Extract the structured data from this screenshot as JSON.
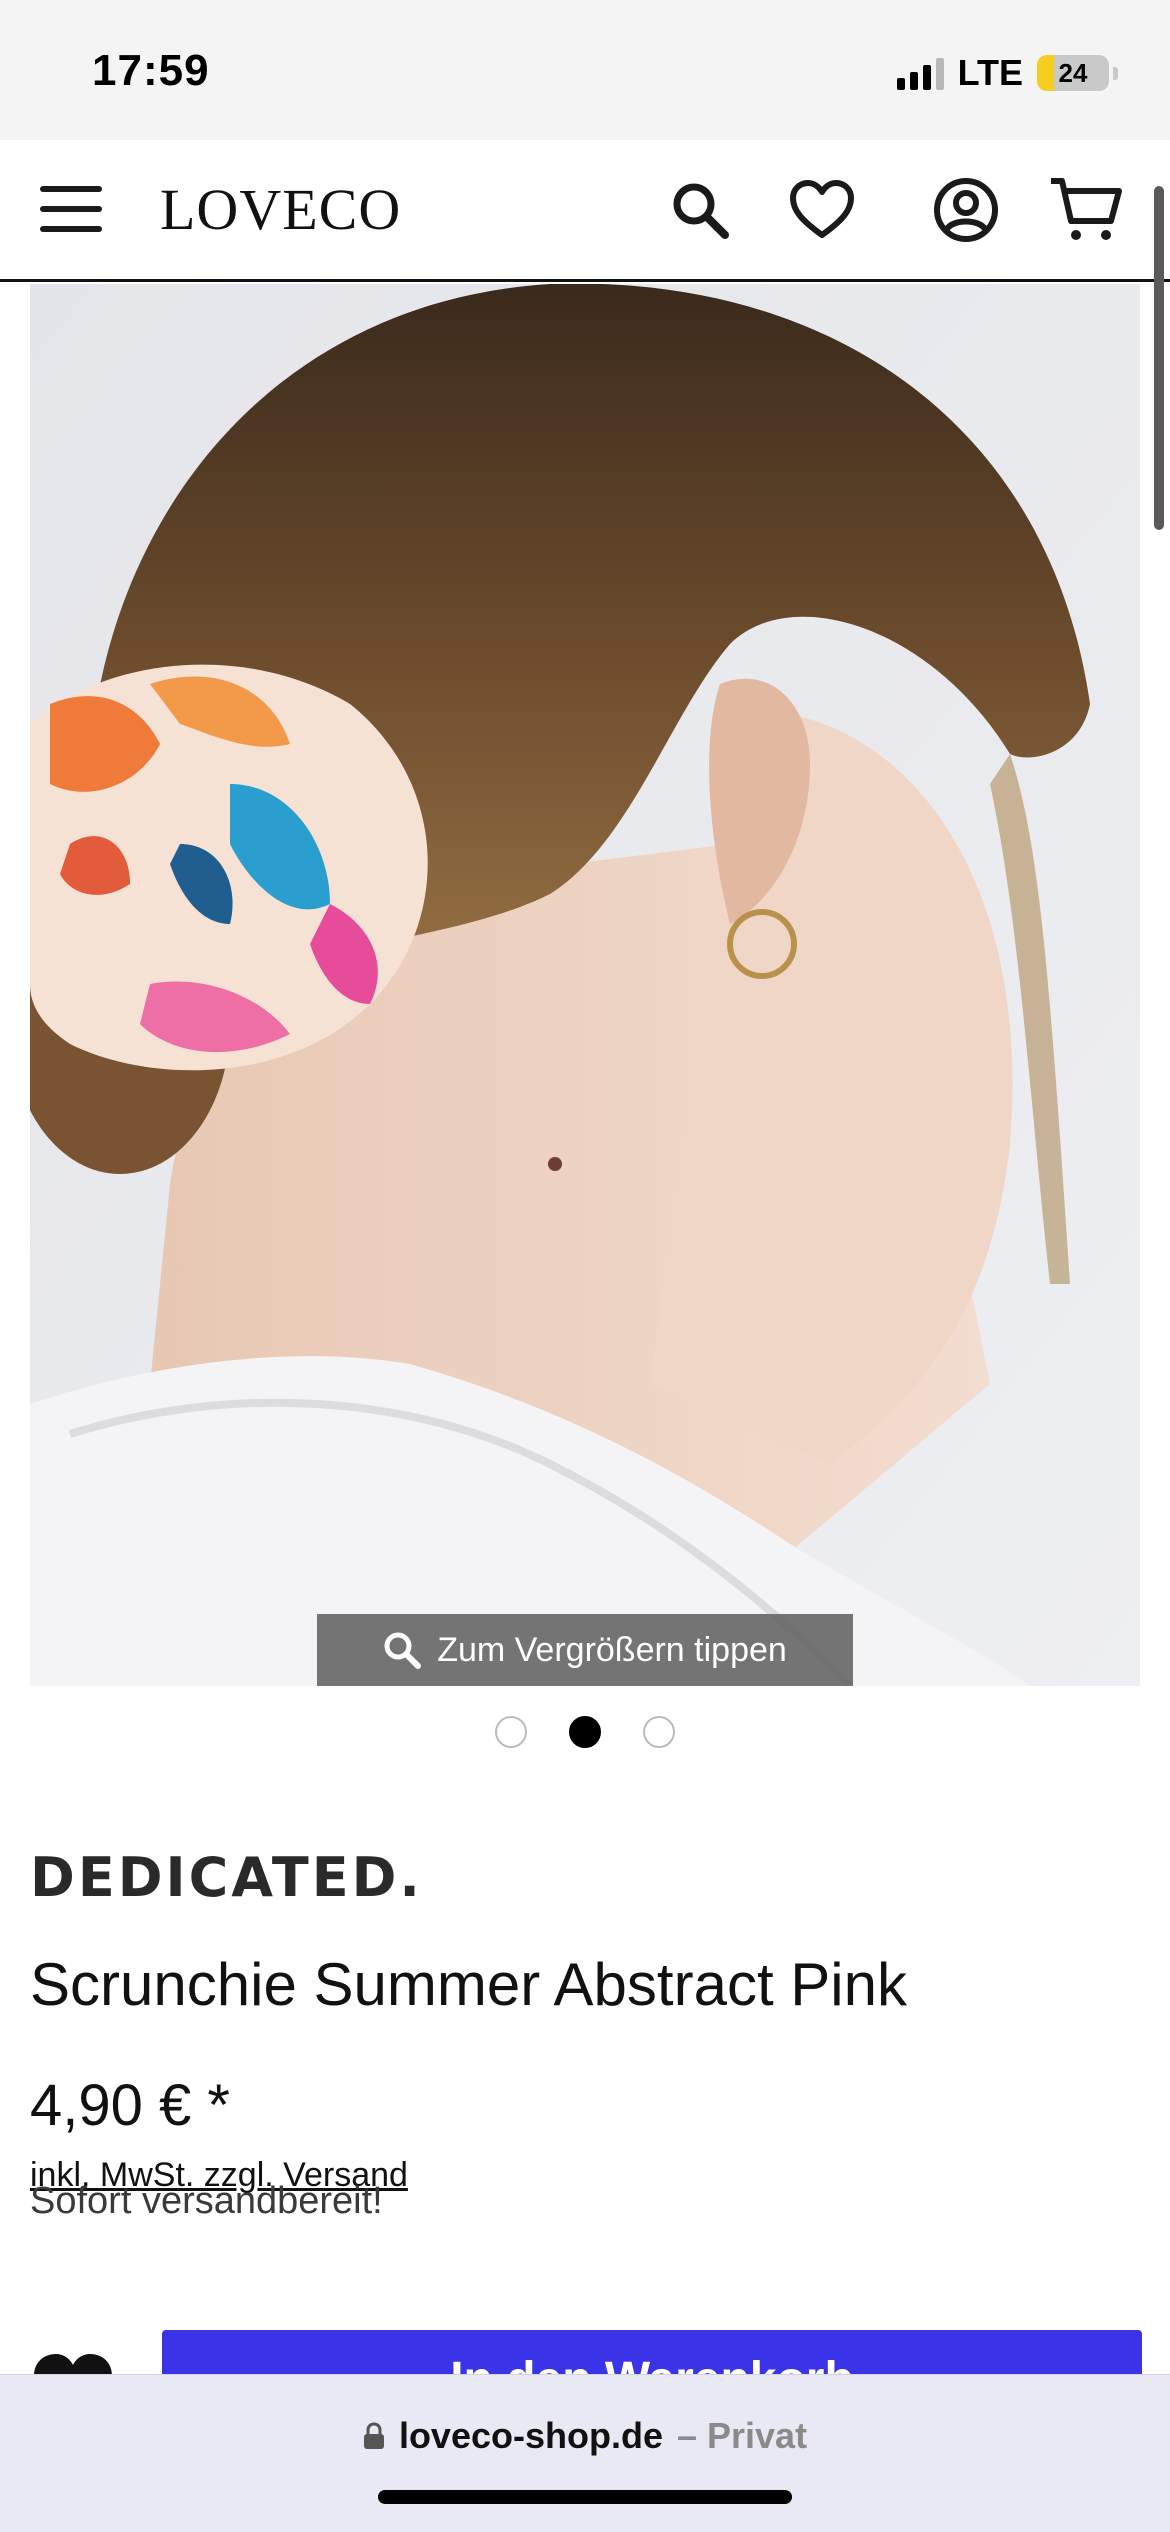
{
  "status_bar": {
    "time": "17:59",
    "network": "LTE",
    "battery_level": "24",
    "battery_color": "#f7cd1f"
  },
  "header": {
    "logo": "LOVECO",
    "icons": [
      "menu-icon",
      "search-icon",
      "heart-icon",
      "account-icon",
      "cart-icon"
    ]
  },
  "gallery": {
    "zoom_hint": "Zum Vergrößern tippen",
    "slide_count": 3,
    "active_slide": 2
  },
  "product": {
    "brand": "DEDICATED.",
    "title": "Scrunchie Summer Abstract Pink",
    "price": "4,90 € *",
    "tax_note": "inkl. MwSt. zzgl. Versand",
    "availability": "Sofort versandbereit!",
    "add_to_cart_label": "In den Warenkorb"
  },
  "browser": {
    "url": "loveco-shop.de",
    "mode": "– Privat"
  },
  "colors": {
    "accent": "#3a33e8",
    "text": "#111111"
  }
}
